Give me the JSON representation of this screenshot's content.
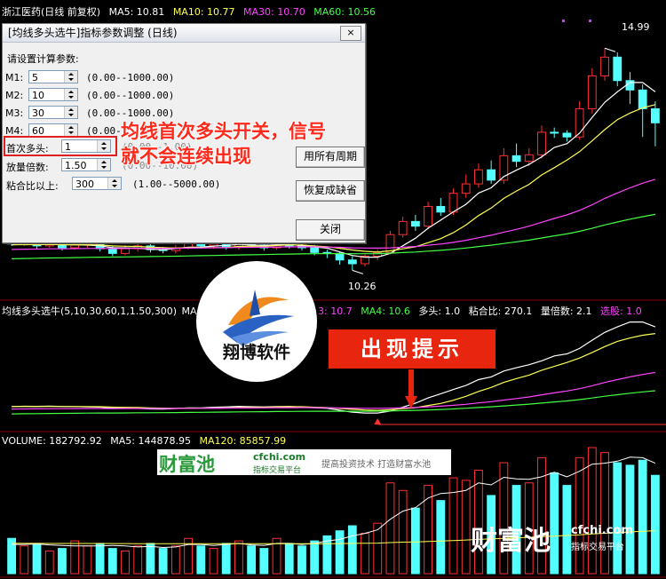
{
  "main_header": {
    "title": "浙江医药(日线 前复权)",
    "ma5": "MA5: 10.81",
    "ma10": "MA10: 10.77",
    "ma30": "MA30: 10.70",
    "ma60": "MA60: 10.56",
    "colors": {
      "title": "#ffffff",
      "ma5": "#ffffff",
      "ma10": "#ffff55",
      "ma30": "#ff44ff",
      "ma60": "#44ff44"
    }
  },
  "price_labels": {
    "high": "14.99",
    "low": "10.26"
  },
  "indicator_header": {
    "name": "均线多头选牛(5,10,30,60,1,1.50,300)",
    "ma_prefix": "MA",
    "ma3_value": "3: 10.7",
    "ma4": "MA4: 10.6",
    "duotou": "多头: 1.0",
    "nianhe": "粘合比: 270.1",
    "liangbei": "量倍数: 2.1",
    "xuanniu": "选股: 1.0"
  },
  "volume_header": {
    "volume": "VOLUME: 182792.92",
    "ma5": "MA5: 144878.95",
    "ma120": "MA120: 85857.99"
  },
  "dialog": {
    "title": "[均线多头选牛]指标参数调整 (日线)",
    "close_label": "×",
    "section_label": "请设置计算参数:",
    "params": [
      {
        "label": "M1:",
        "value": "5",
        "range": "(0.00--1000.00)"
      },
      {
        "label": "M2:",
        "value": "10",
        "range": "(0.00--1000.00)"
      },
      {
        "label": "M3:",
        "value": "30",
        "range": "(0.00--1000.00)"
      },
      {
        "label": "M4:",
        "value": "60",
        "range": "(0.00-"
      },
      {
        "label": "首次多头:",
        "value": "1",
        "range": "(0.00--1.00)"
      },
      {
        "label": "放量倍数:",
        "value": "1.50",
        "range": "(0.00--10.00)"
      },
      {
        "label": "粘合比以上:",
        "value": "300",
        "range": "(1.00--5000.00)"
      }
    ],
    "buttons": {
      "apply_all": "用所有周期",
      "restore": "恢复成缺省",
      "close": "关闭"
    }
  },
  "annotation": {
    "line1": "均线首次多头开关，信号",
    "line2": "就不会连续出现"
  },
  "logo": {
    "text": "翔博软件"
  },
  "hint": {
    "text": "出现提示"
  },
  "watermark": {
    "brand": "财富池",
    "site": "cfchi.com",
    "sub": "指标交易平台",
    "slogan": "提高投资技术 打造财富水池"
  },
  "chart_data": {
    "type": "candlestick",
    "title": "浙江医药(日线 前复权)",
    "series_colors": {
      "up": "#ff3030",
      "down": "#54ffff",
      "ma5": "#ffffff",
      "ma10": "#ffff55",
      "ma30": "#ff44ff",
      "ma60": "#44ff44"
    },
    "price_range": [
      9.7,
      15.6
    ],
    "candles": [
      [
        10.9,
        10.82,
        10.98,
        10.78
      ],
      [
        10.84,
        10.86,
        10.95,
        10.78
      ],
      [
        10.86,
        10.78,
        10.92,
        10.72
      ],
      [
        10.78,
        10.84,
        10.9,
        10.74
      ],
      [
        10.84,
        10.74,
        10.9,
        10.68
      ],
      [
        10.74,
        10.8,
        10.86,
        10.7
      ],
      [
        10.8,
        10.82,
        10.88,
        10.74
      ],
      [
        10.82,
        10.72,
        10.86,
        10.66
      ],
      [
        10.72,
        10.62,
        10.78,
        10.56
      ],
      [
        10.62,
        10.72,
        10.8,
        10.58
      ],
      [
        10.72,
        10.78,
        10.84,
        10.66
      ],
      [
        10.78,
        10.7,
        10.84,
        10.64
      ],
      [
        10.7,
        10.68,
        10.76,
        10.62
      ],
      [
        10.68,
        10.74,
        10.8,
        10.62
      ],
      [
        10.74,
        10.86,
        10.92,
        10.7
      ],
      [
        10.86,
        10.78,
        10.92,
        10.72
      ],
      [
        10.78,
        10.82,
        10.88,
        10.72
      ],
      [
        10.82,
        10.76,
        10.88,
        10.7
      ],
      [
        10.76,
        10.84,
        10.9,
        10.7
      ],
      [
        10.84,
        10.8,
        10.92,
        10.74
      ],
      [
        10.8,
        10.74,
        10.86,
        10.68
      ],
      [
        10.74,
        10.88,
        10.95,
        10.7
      ],
      [
        10.88,
        10.78,
        10.95,
        10.72
      ],
      [
        10.78,
        10.74,
        10.84,
        10.68
      ],
      [
        10.74,
        10.64,
        10.8,
        10.58
      ],
      [
        10.64,
        10.62,
        10.7,
        10.52
      ],
      [
        10.62,
        10.48,
        10.66,
        10.38
      ],
      [
        10.48,
        10.4,
        10.56,
        10.26
      ],
      [
        10.4,
        10.56,
        10.6,
        10.34
      ],
      [
        10.56,
        10.64,
        10.7,
        10.48
      ],
      [
        10.64,
        11.02,
        11.1,
        10.6
      ],
      [
        11.02,
        11.3,
        11.4,
        10.96
      ],
      [
        11.3,
        11.2,
        11.44,
        11.1
      ],
      [
        11.2,
        11.62,
        11.72,
        11.14
      ],
      [
        11.62,
        11.5,
        11.8,
        11.42
      ],
      [
        11.5,
        11.9,
        12.0,
        11.44
      ],
      [
        11.9,
        12.1,
        12.3,
        11.8
      ],
      [
        12.1,
        12.4,
        12.54,
        12.02
      ],
      [
        12.4,
        12.18,
        12.6,
        12.1
      ],
      [
        12.18,
        12.7,
        12.86,
        12.1
      ],
      [
        12.7,
        12.58,
        12.96,
        12.46
      ],
      [
        12.58,
        12.72,
        12.86,
        12.48
      ],
      [
        12.72,
        13.2,
        13.34,
        12.64
      ],
      [
        13.2,
        13.18,
        13.3,
        13.08
      ],
      [
        13.18,
        13.1,
        13.24,
        13.0
      ],
      [
        13.1,
        13.7,
        13.86,
        13.04
      ],
      [
        13.7,
        14.4,
        14.56,
        13.6
      ],
      [
        14.4,
        14.8,
        14.99,
        14.3
      ],
      [
        14.8,
        14.3,
        14.9,
        14.18
      ],
      [
        14.3,
        14.1,
        14.48,
        13.8
      ],
      [
        14.1,
        13.7,
        14.22,
        13.1
      ],
      [
        13.7,
        13.4,
        13.86,
        12.9
      ]
    ],
    "volumes": [
      0.28,
      0.22,
      0.24,
      0.18,
      0.2,
      0.26,
      0.22,
      0.24,
      0.2,
      0.18,
      0.22,
      0.24,
      0.2,
      0.22,
      0.28,
      0.22,
      0.2,
      0.24,
      0.26,
      0.22,
      0.2,
      0.28,
      0.24,
      0.22,
      0.26,
      0.3,
      0.34,
      0.38,
      0.32,
      0.4,
      0.72,
      0.66,
      0.52,
      0.7,
      0.58,
      0.76,
      0.74,
      0.82,
      0.62,
      0.88,
      0.7,
      0.72,
      0.92,
      0.8,
      0.7,
      0.92,
      1.0,
      0.96,
      0.88,
      0.86,
      0.9,
      0.78
    ]
  }
}
